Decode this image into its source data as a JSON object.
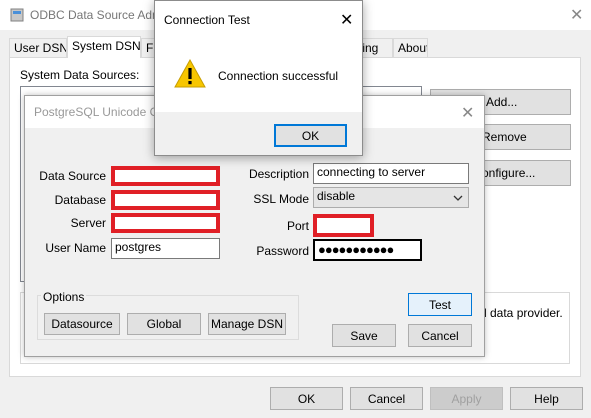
{
  "admin_window": {
    "title": "ODBC Data Source Adm",
    "tabs": [
      "User DSN",
      "System DSN",
      "Fil",
      "oling",
      "About"
    ],
    "active_tab": "System DSN",
    "system_sources_label": "System Data Sources:",
    "side_buttons": {
      "add": "Add...",
      "remove": "Remove",
      "configure": "onfigure..."
    },
    "provider_text": "l data provider.",
    "footer_buttons": {
      "ok": "OK",
      "cancel": "Cancel",
      "apply": "Apply",
      "help": "Help"
    }
  },
  "setup_dialog": {
    "title": "PostgreSQL Unicode O",
    "fields": {
      "data_source_label": "Data Source",
      "database_label": "Database",
      "server_label": "Server",
      "user_name_label": "User Name",
      "user_name_value": "postgres",
      "description_label": "Description",
      "description_value": "connecting to server",
      "ssl_mode_label": "SSL Mode",
      "ssl_mode_value": "disable",
      "port_label": "Port",
      "password_label": "Password",
      "password_value": "●●●●●●●●●●●"
    },
    "options_label": "Options",
    "option_buttons": {
      "datasource": "Datasource",
      "global": "Global",
      "manage_dsn": "Manage DSN"
    },
    "buttons": {
      "test": "Test",
      "save": "Save",
      "cancel": "Cancel"
    }
  },
  "message_box": {
    "title": "Connection Test",
    "message": "Connection successful",
    "ok": "OK",
    "icon": "warning-icon"
  },
  "colors": {
    "accent": "#0078d7",
    "redaction": "#e01f26",
    "warning_yellow": "#f7c600"
  }
}
